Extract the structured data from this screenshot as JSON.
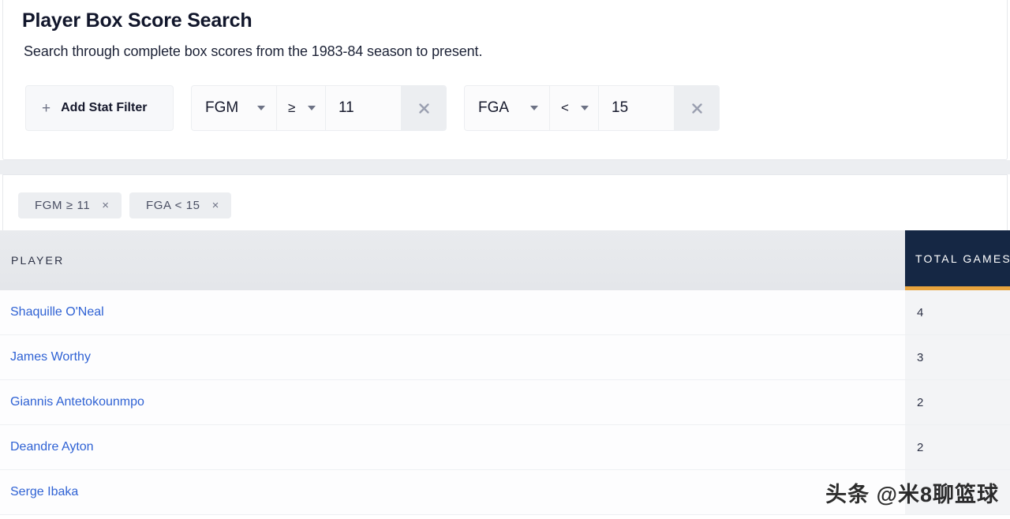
{
  "header": {
    "title": "Player Box Score Search",
    "subtitle": "Search through complete box scores from the 1983-84 season to present."
  },
  "filter_bar": {
    "add_filter_label": "Add Stat Filter",
    "plus_icon": "plus-icon",
    "remove_icon": "close-icon",
    "filters": [
      {
        "stat": "FGM",
        "operator": "≥",
        "value": "11"
      },
      {
        "stat": "FGA",
        "operator": "<",
        "value": "15"
      }
    ]
  },
  "active_chips": [
    {
      "label": "FGM ≥ 11",
      "remove_icon": "×"
    },
    {
      "label": "FGA < 15",
      "remove_icon": "×"
    }
  ],
  "results_table": {
    "columns": [
      "PLAYER",
      "TOTAL GAMES"
    ],
    "sorted_column": "TOTAL GAMES",
    "accent_color": "#e8a33d",
    "header_dark_color": "#152744",
    "link_color": "#2f62d4",
    "rows": [
      {
        "player": "Shaquille O'Neal",
        "total_games": "4"
      },
      {
        "player": "James Worthy",
        "total_games": "3"
      },
      {
        "player": "Giannis Antetokounmpo",
        "total_games": "2"
      },
      {
        "player": "Deandre Ayton",
        "total_games": "2"
      },
      {
        "player": "Serge Ibaka",
        "total_games": ""
      }
    ]
  },
  "watermark": {
    "text": "头条 @米8聊篮球"
  }
}
